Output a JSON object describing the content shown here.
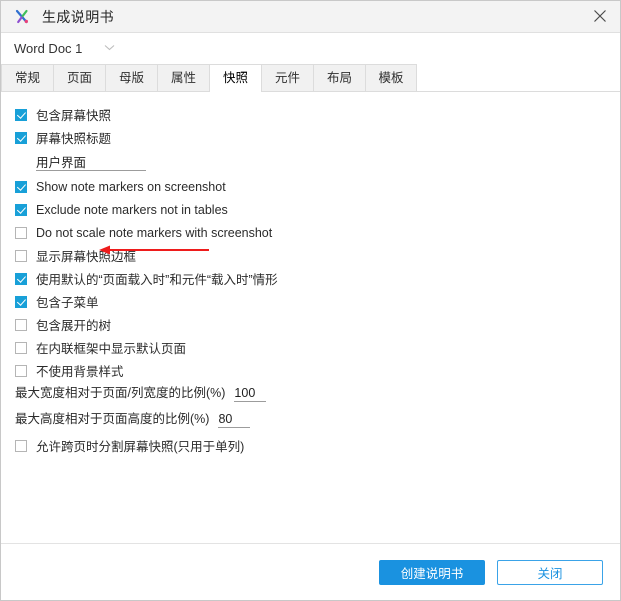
{
  "window": {
    "title": "生成说明书",
    "logo_icon": "axure-x-logo-icon",
    "close_icon": "close-icon"
  },
  "doc_selector": {
    "value": "Word Doc 1",
    "caret_icon": "chevron-down-icon"
  },
  "tabs": [
    {
      "label": "常规",
      "active": false
    },
    {
      "label": "页面",
      "active": false
    },
    {
      "label": "母版",
      "active": false
    },
    {
      "label": "属性",
      "active": false
    },
    {
      "label": "快照",
      "active": true
    },
    {
      "label": "元件",
      "active": false
    },
    {
      "label": "布局",
      "active": false
    },
    {
      "label": "模板",
      "active": false
    }
  ],
  "options": [
    {
      "label": "包含屏幕快照",
      "checked": true
    },
    {
      "label": "屏幕快照标题",
      "checked": true
    },
    {
      "label": "Show note markers on screenshot",
      "checked": true
    },
    {
      "label": "Exclude note markers not in tables",
      "checked": true
    },
    {
      "label": "Do not scale note markers with screenshot",
      "checked": false
    },
    {
      "label": "显示屏幕快照边框",
      "checked": false
    },
    {
      "label": "使用默认的“页面载入时”和元件“载入时”情形",
      "checked": true
    },
    {
      "label": "包含子菜单",
      "checked": true
    },
    {
      "label": "包含展开的树",
      "checked": false
    },
    {
      "label": "在内联框架中显示默认页面",
      "checked": false
    },
    {
      "label": "不使用背景样式",
      "checked": false
    }
  ],
  "snapshot_title_field": {
    "value": "用户界面",
    "placeholder": ""
  },
  "max_width": {
    "label": "最大宽度相对于页面/列宽度的比例(%)",
    "value": "100"
  },
  "max_height": {
    "label": "最大高度相对于页面高度的比例(%)",
    "value": "80"
  },
  "split_option": {
    "label": "允许跨页时分割屏幕快照(只用于单列)",
    "checked": false
  },
  "footer": {
    "primary_label": "创建说明书",
    "secondary_label": "关闭"
  },
  "annotation": {
    "arrow_icon": "red-left-arrow-annotation-icon",
    "color": "#ee1c1c"
  },
  "colors": {
    "accent": "#1a92e0",
    "checkbox_checked": "#18a0d8",
    "annotation_red": "#ee1c1c",
    "titlebar_bg": "#f3f3f3",
    "tab_inactive_bg": "#f1f1f1"
  }
}
